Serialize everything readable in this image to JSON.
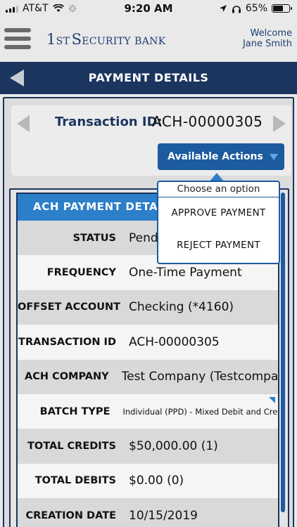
{
  "status_bar": {
    "carrier": "AT&T",
    "time": "9:20 AM",
    "battery": "65%",
    "battery_level": 0.65
  },
  "header": {
    "logo_prefix": "1",
    "logo_st": "ST",
    "logo_s": "S",
    "logo_ecurity": "ECURITY",
    "logo_bank": "BANK",
    "welcome_line1": "Welcome",
    "welcome_line2": "Jane Smith"
  },
  "title_bar": {
    "title": "PAYMENT DETAILS"
  },
  "transaction": {
    "label": "Transaction ID:",
    "value": "ACH-00000305"
  },
  "actions": {
    "button_label": "Available Actions",
    "dropdown_title": "Choose an option",
    "options": [
      "APPROVE PAYMENT",
      "REJECT PAYMENT"
    ]
  },
  "details": {
    "section_title": "ACH  PAYMENT DETAIL",
    "rows": [
      {
        "label": "STATUS",
        "value": "Pendi"
      },
      {
        "label": "FREQUENCY",
        "value": "One-Time Payment"
      },
      {
        "label": "OFFSET ACCOUNT",
        "value": "Checking (*4160)"
      },
      {
        "label": "TRANSACTION ID",
        "value": "ACH-00000305"
      },
      {
        "label": "ACH COMPANY",
        "value": "Test Company (Testcompan)"
      },
      {
        "label": "BATCH TYPE",
        "value": "Individual (PPD) - Mixed Debit and Credit"
      },
      {
        "label": "TOTAL CREDITS",
        "value": "$50,000.00 (1)"
      },
      {
        "label": "TOTAL DEBITS",
        "value": "$0.00 (0)"
      },
      {
        "label": "CREATION DATE",
        "value": "10/15/2019"
      }
    ]
  }
}
